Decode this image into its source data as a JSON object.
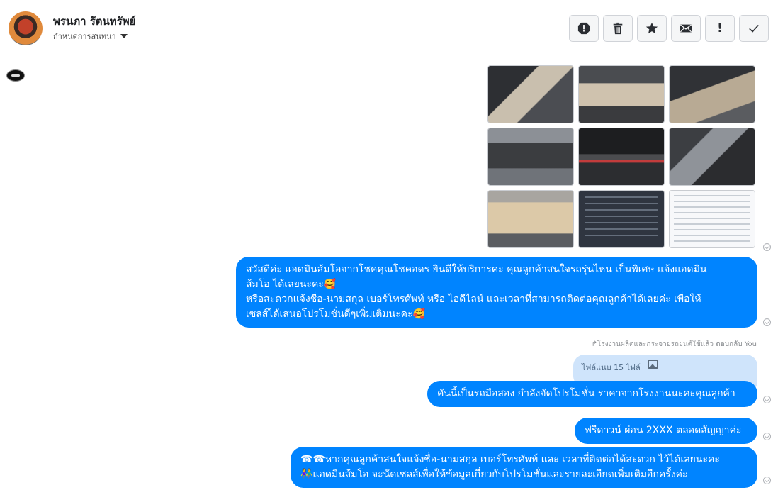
{
  "header": {
    "contact_name": "พรนภา รัตนทรัพย์",
    "subtitle": "กำหนดการสนทนา",
    "actions": [
      {
        "name": "report-icon"
      },
      {
        "name": "trash-icon"
      },
      {
        "name": "star-icon"
      },
      {
        "name": "envelope-icon"
      },
      {
        "name": "exclamation-icon",
        "label": "!"
      },
      {
        "name": "checkmark-icon"
      }
    ]
  },
  "thread": {
    "photos_count": 9,
    "messages": [
      {
        "lines": [
          "สวัสดีค่ะ แอดมินส้มโอจากโชคคุณโชคอดร ยินดีให้บริการค่ะ   คุณลูกค้าสนใจรถรุ่นไหน เป็นพิเศษ แจ้งแอดมิน",
          "ส้มโอ ได้เลยนะคะ🥰",
          "หรือสะดวกแจ้งชื่อ-นามสกุล เบอร์โทรศัพท์ หรือ ไอดีไลน์ และเวลาที่สามารถติดต่อคุณลูกค้าได้เลยค่ะ เพื่อให้",
          "เซลส์ได้เสนอโปรโมชั่นดีๆเพิ่มเติมนะคะ🥰"
        ]
      },
      {
        "lines": [
          "คันนี้เป็นรถมือสอง กำลังจัดโปรโมชั่น ราคาจากโรงงานนะคะคุณลูกค้า"
        ]
      },
      {
        "lines": [
          "ฟรีดาวน์ ผ่อน 2XXX ตลอดสัญญาค่ะ"
        ]
      },
      {
        "lines": [
          "☎☎หากคุณลูกค้าสนใจแจ้งชื่อ-นามสกุล เบอร์โทรศัพท์ และ เวลาที่ติดต่อได้สะดวก ไว้ได้เลยนะคะ",
          "👫แอดมินส้มโอ จะนัดเซลส์เพื่อให้ข้อมูลเกี่ยวกับโปรโมชั่นและรายละเอียดเพิ่มเติมอีกครั้งค่ะ"
        ]
      }
    ],
    "reply_note": "↱โรงงานผลิตและกระจายรถยนต์ใช้แล้ว ตอบกลับ You",
    "quoted_attachment": "ไฟล์แนบ 15 ไฟล์"
  }
}
